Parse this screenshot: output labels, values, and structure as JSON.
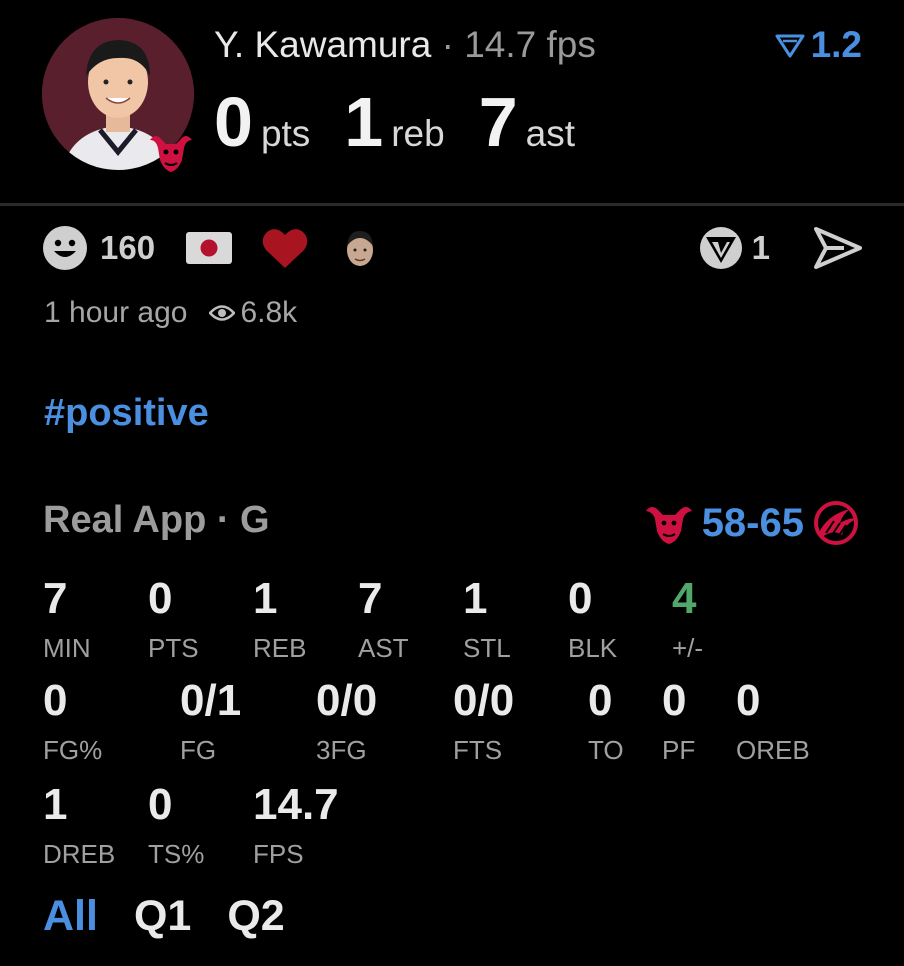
{
  "header": {
    "player_name": "Y. Kawamura",
    "separator": " · ",
    "fps_label": "14.7 fps",
    "vote_value": "1.2",
    "statline": [
      {
        "value": "0",
        "unit": "pts"
      },
      {
        "value": "1",
        "unit": "reb"
      },
      {
        "value": "7",
        "unit": "ast"
      }
    ]
  },
  "reactions": {
    "count": "160",
    "right_count": "1"
  },
  "meta": {
    "time_ago": "1 hour ago",
    "views": "6.8k"
  },
  "tag": "#positive",
  "game": {
    "source": "Real App · G",
    "score": "58-65"
  },
  "stats": [
    {
      "value": "7",
      "label": "MIN"
    },
    {
      "value": "0",
      "label": "PTS"
    },
    {
      "value": "1",
      "label": "REB"
    },
    {
      "value": "7",
      "label": "AST"
    },
    {
      "value": "1",
      "label": "STL"
    },
    {
      "value": "0",
      "label": "BLK"
    },
    {
      "value": "4",
      "label": "+/-"
    },
    {
      "value": "0",
      "label": "FG%"
    },
    {
      "value": "0/1",
      "label": "FG"
    },
    {
      "value": "0/0",
      "label": "3FG"
    },
    {
      "value": "0/0",
      "label": "FTS"
    },
    {
      "value": "0",
      "label": "TO"
    },
    {
      "value": "0",
      "label": "PF"
    },
    {
      "value": "0",
      "label": "OREB"
    },
    {
      "value": "1",
      "label": "DREB"
    },
    {
      "value": "0",
      "label": "TS%"
    },
    {
      "value": "14.7",
      "label": "FPS"
    }
  ],
  "tabs": [
    "All",
    "Q1",
    "Q2"
  ],
  "colors": {
    "accent": "#4a8fe0",
    "positive": "#52a86a",
    "bulls_red": "#ce1141",
    "raptors_red": "#ce1141"
  }
}
